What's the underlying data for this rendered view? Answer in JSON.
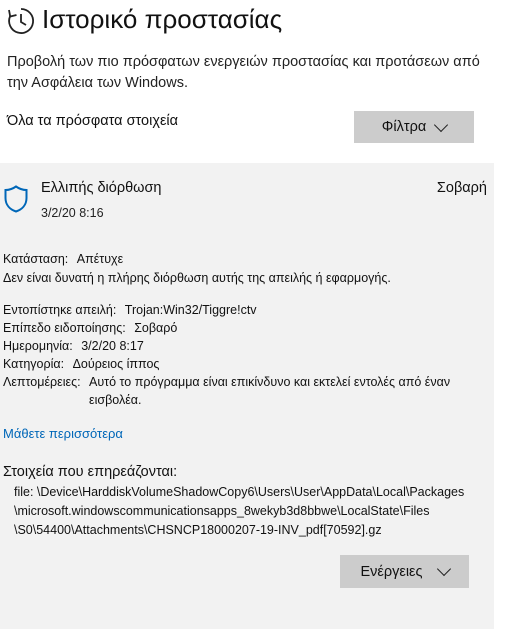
{
  "header": {
    "title": "Ιστορικό προστασίας",
    "icon": "history-icon"
  },
  "description": "Προβολή των πιο πρόσφατων ενεργειών προστασίας και προτάσεων από την Ασφάλεια των Windows.",
  "filter_section": {
    "label": "Όλα τα πρόσφατα στοιχεία",
    "filter_button": "Φίλτρα"
  },
  "item": {
    "icon": "shield-icon",
    "name": "Ελλιπής διόρθωση",
    "date": "3/2/20 8:16",
    "severity": "Σοβαρή",
    "status_label": "Κατάσταση:",
    "status_value": "Απέτυχε",
    "status_message": "Δεν είναι δυνατή η πλήρης διόρθωση αυτής της απειλής ή εφαρμογής.",
    "threat_label": "Εντοπίστηκε απειλή:",
    "threat_value": "Trojan:Win32/Tiggre!ctv",
    "alert_label": "Επίπεδο ειδοποίησης:",
    "alert_value": "Σοβαρό",
    "date_label": "Ημερομηνία:",
    "date_value": "3/2/20 8:17",
    "category_label": "Κατηγορία:",
    "category_value": "Δούρειος ίππος",
    "details_label": "Λεπτομέρειες:",
    "details_value": "Αυτό το πρόγραμμα είναι επικίνδυνο και εκτελεί εντολές από έναν εισβολέα.",
    "learn_more": "Μάθετε περισσότερα",
    "affected_title": "Στοιχεία που επηρεάζονται:",
    "affected_path_lines": [
      "file: \\Device\\HarddiskVolumeShadowCopy6\\Users\\User\\AppData\\Local\\Packages",
      "\\microsoft.windowscommunicationsapps_8wekyb3d8bbwe\\LocalState\\Files",
      "\\S0\\54400\\Attachments\\CHSNCP18000207-19-INV_pdf[70592].gz"
    ],
    "actions_button": "Ενέργειες"
  },
  "colors": {
    "accent": "#0067b8",
    "card_background": "#f2f2f2",
    "button_background": "#cccccc"
  }
}
